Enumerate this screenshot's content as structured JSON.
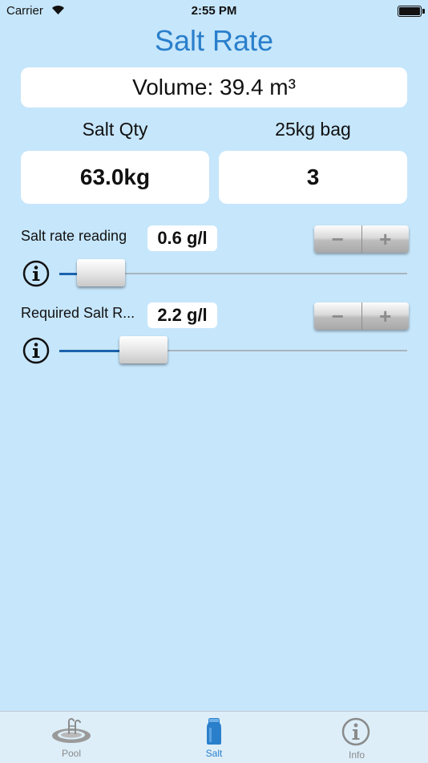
{
  "status_bar": {
    "carrier": "Carrier",
    "time": "2:55 PM"
  },
  "title": "Salt Rate",
  "volume": {
    "text": "Volume: 39.4 m³"
  },
  "columns": {
    "qty_label": "Salt Qty",
    "bag_label": "25kg bag",
    "qty_value": "63.0kg",
    "bag_value": "3"
  },
  "salt_rate_reading": {
    "label": "Salt rate reading",
    "value": "0.6 g/l",
    "slider_fraction": 0.06
  },
  "required_salt_rate": {
    "label": "Required Salt R...",
    "value": "2.2 g/l",
    "slider_fraction": 0.2
  },
  "stepper": {
    "minus": "−",
    "plus": "+"
  },
  "tabs": [
    {
      "label": "Pool",
      "icon": "pool-icon",
      "active": false
    },
    {
      "label": "Salt",
      "icon": "salt-shaker-icon",
      "active": true
    },
    {
      "label": "Info",
      "icon": "info-icon",
      "active": false
    }
  ],
  "colors": {
    "background": "#c6e6fb",
    "accent": "#2a7fcb",
    "slider_fill": "#1b63ad"
  }
}
